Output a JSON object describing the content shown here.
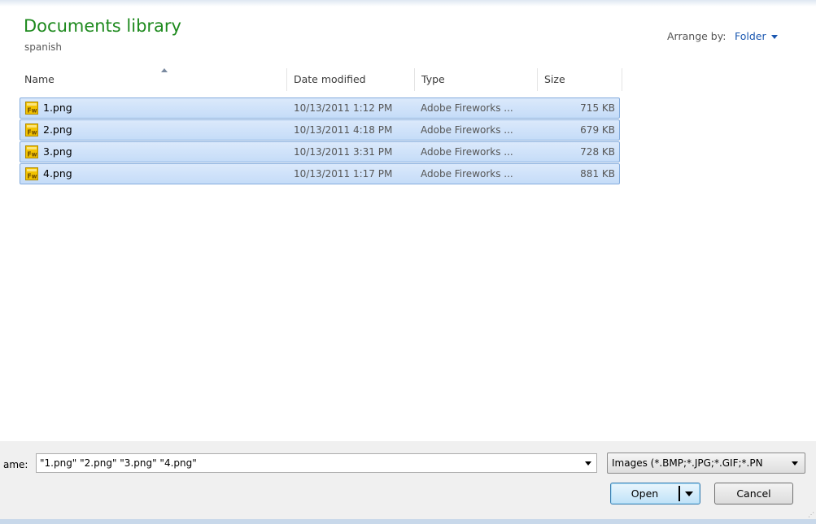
{
  "header": {
    "title": "Documents library",
    "subtitle": "spanish",
    "arrange_label": "Arrange by:",
    "arrange_value": "Folder"
  },
  "columns": {
    "name": "Name",
    "date": "Date modified",
    "type": "Type",
    "size": "Size"
  },
  "files": [
    {
      "name": "1.png",
      "date": "10/13/2011 1:12 PM",
      "type": "Adobe Fireworks ...",
      "size": "715 KB",
      "icon": "fireworks-file-icon"
    },
    {
      "name": "2.png",
      "date": "10/13/2011 4:18 PM",
      "type": "Adobe Fireworks ...",
      "size": "679 KB",
      "icon": "fireworks-file-icon"
    },
    {
      "name": "3.png",
      "date": "10/13/2011 3:31 PM",
      "type": "Adobe Fireworks ...",
      "size": "728 KB",
      "icon": "fireworks-file-icon"
    },
    {
      "name": "4.png",
      "date": "10/13/2011 1:17 PM",
      "type": "Adobe Fireworks ...",
      "size": "881 KB",
      "icon": "fireworks-file-icon"
    }
  ],
  "footer": {
    "filename_label": "ame:",
    "filename_value": "\"1.png\" \"2.png\" \"3.png\" \"4.png\"",
    "filetype_value": "Images (*.BMP;*.JPG;*.GIF;*.PN",
    "open_label": "Open",
    "cancel_label": "Cancel"
  },
  "colors": {
    "title_green": "#1e8a1e",
    "link_blue": "#1a57b0",
    "selection_border": "#84acdd",
    "selection_fill": "#cce0f9"
  }
}
